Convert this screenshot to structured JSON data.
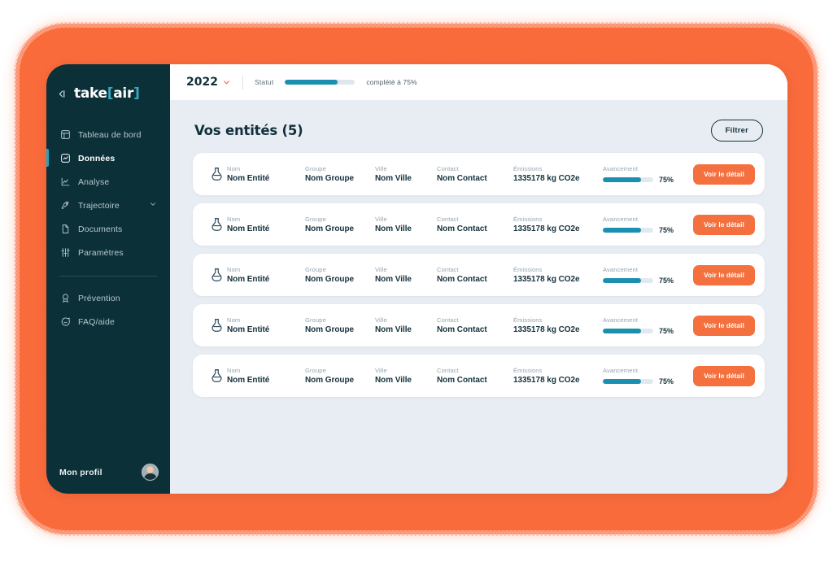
{
  "sidebar": {
    "collapse_icon": "collapse-left-icon",
    "logo": {
      "prefix": "take",
      "bracket_open": "[",
      "middle": "air",
      "bracket_close": "]"
    },
    "items": [
      {
        "label": "Tableau de bord",
        "icon": "dashboard-icon",
        "active": false
      },
      {
        "label": "Données",
        "icon": "data-chart-icon",
        "active": true
      },
      {
        "label": "Analyse",
        "icon": "analysis-chart-icon",
        "active": false
      },
      {
        "label": "Trajectoire",
        "icon": "rocket-icon",
        "active": false,
        "chevron": "chevron-down-icon"
      },
      {
        "label": "Documents",
        "icon": "document-icon",
        "active": false
      },
      {
        "label": "Paramètres",
        "icon": "sliders-icon",
        "active": false
      }
    ],
    "secondary_items": [
      {
        "label": "Prévention",
        "icon": "award-icon"
      },
      {
        "label": "FAQ/aide",
        "icon": "chat-smile-icon"
      }
    ],
    "profile": {
      "label": "Mon profil",
      "avatar": "avatar-icon"
    }
  },
  "topbar": {
    "year": "2022",
    "year_chevron": "chevron-down-icon",
    "statut_label": "Statut",
    "progress_percent": 75,
    "progress_text": "complété à 75%"
  },
  "main": {
    "title": "Vos entités (5)",
    "filter_label": "Filtrer",
    "columns": {
      "nom": "Nom",
      "groupe": "Groupe",
      "ville": "Ville",
      "contact": "Contact",
      "emissions": "Émissions",
      "avancement": "Avancement"
    },
    "detail_label": "Voir le détail",
    "row_icon": "flask-icon",
    "rows": [
      {
        "nom": "Nom Entité",
        "groupe": "Nom Groupe",
        "ville": "Nom Ville",
        "contact": "Nom Contact",
        "emissions": "1335178 kg CO2e",
        "avancement": 75,
        "avancement_text": "75%"
      },
      {
        "nom": "Nom Entité",
        "groupe": "Nom Groupe",
        "ville": "Nom Ville",
        "contact": "Nom Contact",
        "emissions": "1335178 kg CO2e",
        "avancement": 75,
        "avancement_text": "75%"
      },
      {
        "nom": "Nom Entité",
        "groupe": "Nom Groupe",
        "ville": "Nom Ville",
        "contact": "Nom Contact",
        "emissions": "1335178 kg CO2e",
        "avancement": 75,
        "avancement_text": "75%"
      },
      {
        "nom": "Nom Entité",
        "groupe": "Nom Groupe",
        "ville": "Nom Ville",
        "contact": "Nom Contact",
        "emissions": "1335178 kg CO2e",
        "avancement": 75,
        "avancement_text": "75%"
      },
      {
        "nom": "Nom Entité",
        "groupe": "Nom Groupe",
        "ville": "Nom Ville",
        "contact": "Nom Contact",
        "emissions": "1335178 kg CO2e",
        "avancement": 75,
        "avancement_text": "75%"
      }
    ]
  },
  "colors": {
    "frame_orange": "#fa6b3c",
    "sidebar_dark": "#0c3038",
    "accent_teal": "#23a4bf",
    "progress_blue": "#1a8fb0",
    "cta_orange": "#f4713f",
    "content_bg": "#e7edf2"
  }
}
